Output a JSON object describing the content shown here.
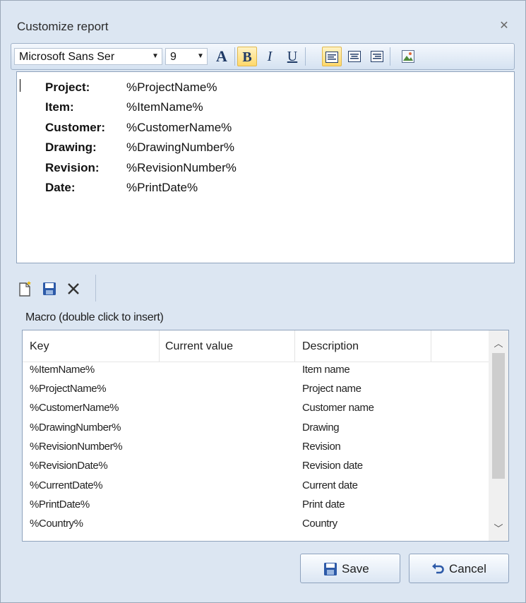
{
  "window": {
    "title": "Customize report"
  },
  "toolbar": {
    "font_name": "Microsoft Sans Ser",
    "font_size": "9",
    "font_color_glyph": "A",
    "bold_glyph": "B",
    "italic_glyph": "I",
    "underline_glyph": "U"
  },
  "editor": {
    "rows": [
      {
        "key": "Project:",
        "value": "%ProjectName%"
      },
      {
        "key": "Item:",
        "value": "%ItemName%"
      },
      {
        "key": "Customer:",
        "value": "%CustomerName%"
      },
      {
        "key": "Drawing:",
        "value": "%DrawingNumber%"
      },
      {
        "key": "Revision:",
        "value": "%RevisionNumber%"
      },
      {
        "key": "Date:",
        "value": "%PrintDate%"
      }
    ]
  },
  "macro": {
    "label": "Macro (double click to insert)",
    "columns": [
      "Key",
      "Current value",
      "Description"
    ],
    "rows": [
      {
        "key": "%ItemName%",
        "current": "",
        "description": "Item name"
      },
      {
        "key": "%ProjectName%",
        "current": "",
        "description": "Project name"
      },
      {
        "key": "%CustomerName%",
        "current": "",
        "description": "Customer name"
      },
      {
        "key": "%DrawingNumber%",
        "current": "",
        "description": "Drawing"
      },
      {
        "key": "%RevisionNumber%",
        "current": "",
        "description": "Revision"
      },
      {
        "key": "%RevisionDate%",
        "current": "",
        "description": "Revision date"
      },
      {
        "key": "%CurrentDate%",
        "current": "",
        "description": "Current date"
      },
      {
        "key": "%PrintDate%",
        "current": "",
        "description": "Print date"
      },
      {
        "key": "%Country%",
        "current": "",
        "description": "Country"
      }
    ]
  },
  "buttons": {
    "save": "Save",
    "cancel": "Cancel"
  },
  "colors": {
    "window_bg": "#dce6f2",
    "highlight": "#ffd86a",
    "icon_blue": "#1f3a66"
  }
}
